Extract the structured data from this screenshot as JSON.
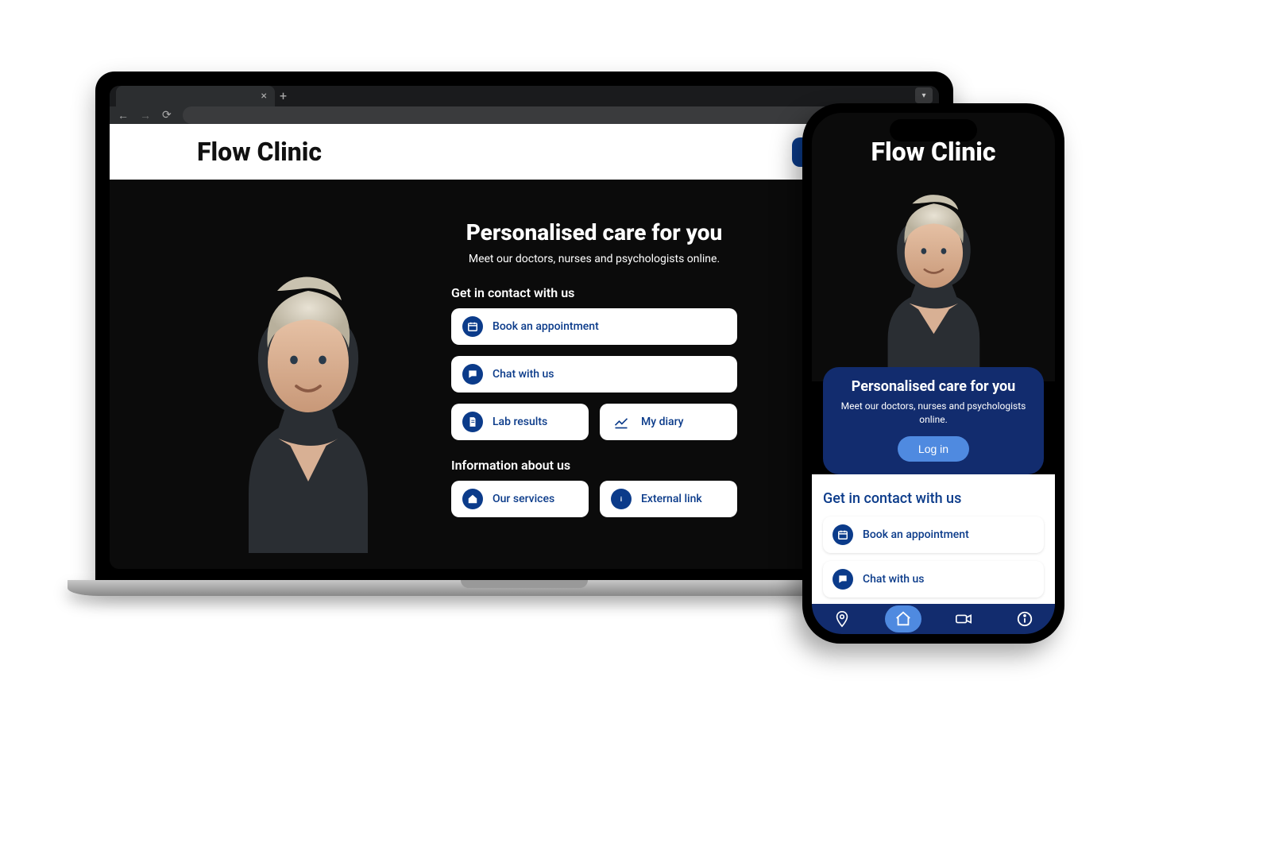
{
  "brand": "Flow Clinic",
  "login_label": "Log in",
  "hero": {
    "title": "Personalised care for you",
    "subtitle": "Meet our doctors, nurses and psychologists online."
  },
  "contact": {
    "heading": "Get in contact with us",
    "book": "Book an appointment",
    "chat": "Chat with us",
    "lab": "Lab results",
    "diary": "My diary"
  },
  "info": {
    "heading": "Information about us",
    "services": "Our services",
    "external": "External link"
  },
  "icons": {
    "calendar": "calendar-icon",
    "chat": "chat-icon",
    "document": "document-icon",
    "chart": "chart-icon",
    "home": "home-icon",
    "info": "info-icon",
    "pin": "pin-icon",
    "video": "video-icon"
  },
  "colors": {
    "primary": "#0b3b8a",
    "dark_panel": "#122c6e",
    "accent": "#4f8ae0"
  }
}
